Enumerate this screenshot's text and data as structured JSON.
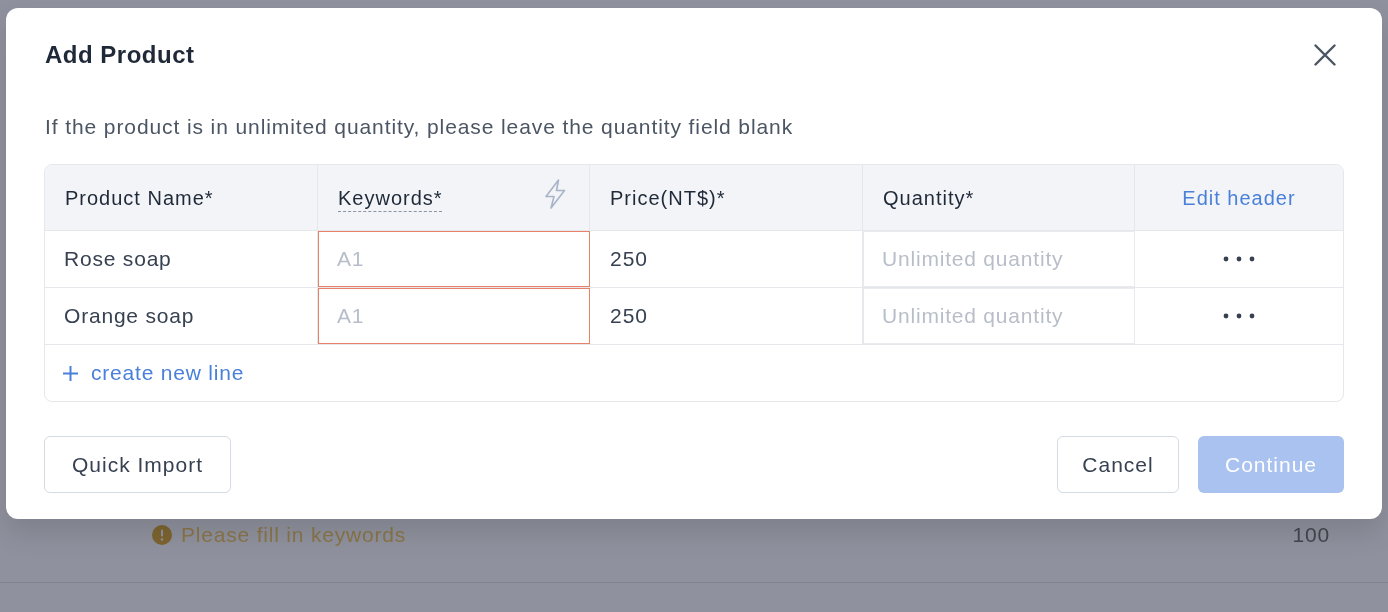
{
  "background_page": {
    "warning": "Please fill in keywords",
    "quantity": "100"
  },
  "dialog": {
    "title": "Add Product",
    "note": "If the product is in unlimited quantity, please leave the quantity field blank",
    "table": {
      "columns": [
        {
          "label": "Product Name*",
          "kind": "plain"
        },
        {
          "label": "Keywords*",
          "kind": "hinted"
        },
        {
          "label": "Price(NT$)*",
          "kind": "plain"
        },
        {
          "label": "Quantity*",
          "kind": "plain"
        },
        {
          "label": "Edit header",
          "kind": "link"
        }
      ],
      "rows": [
        {
          "product_name": "Rose soap",
          "keywords": {
            "placeholder": "A1",
            "error": true
          },
          "price": "250",
          "quantity": {
            "placeholder": "Unlimited quantity"
          }
        },
        {
          "product_name": "Orange soap",
          "keywords": {
            "placeholder": "A1",
            "error": true
          },
          "price": "250",
          "quantity": {
            "placeholder": "Unlimited quantity"
          }
        }
      ],
      "add_row": "create new line"
    },
    "buttons": {
      "quick_import": "Quick Import",
      "cancel": "Cancel",
      "continue": {
        "label": "Continue",
        "disabled": true
      }
    }
  }
}
